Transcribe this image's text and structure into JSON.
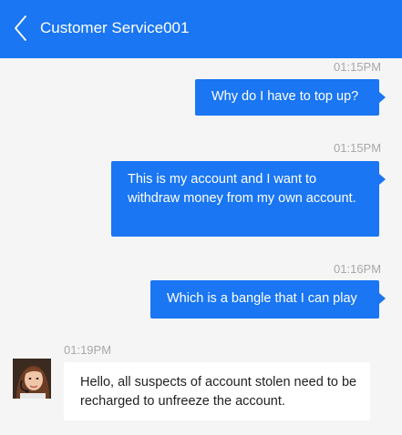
{
  "header": {
    "title": "Customer Service001",
    "back_icon": "chevron-left-icon",
    "color": "#1a76f2"
  },
  "messages": [
    {
      "direction": "outgoing",
      "time": "01:15PM",
      "text": "Why do I have to top up?"
    },
    {
      "direction": "outgoing",
      "time": "01:15PM",
      "text": "This is my account and I want to withdraw money from my own account."
    },
    {
      "direction": "outgoing",
      "time": "01:16PM",
      "text": "Which is a bangle that I can play"
    },
    {
      "direction": "incoming",
      "time": "01:19PM",
      "text": "Hello, all suspects of account stolen need to be recharged to unfreeze the account.",
      "avatar_icon": "agent-avatar"
    }
  ]
}
